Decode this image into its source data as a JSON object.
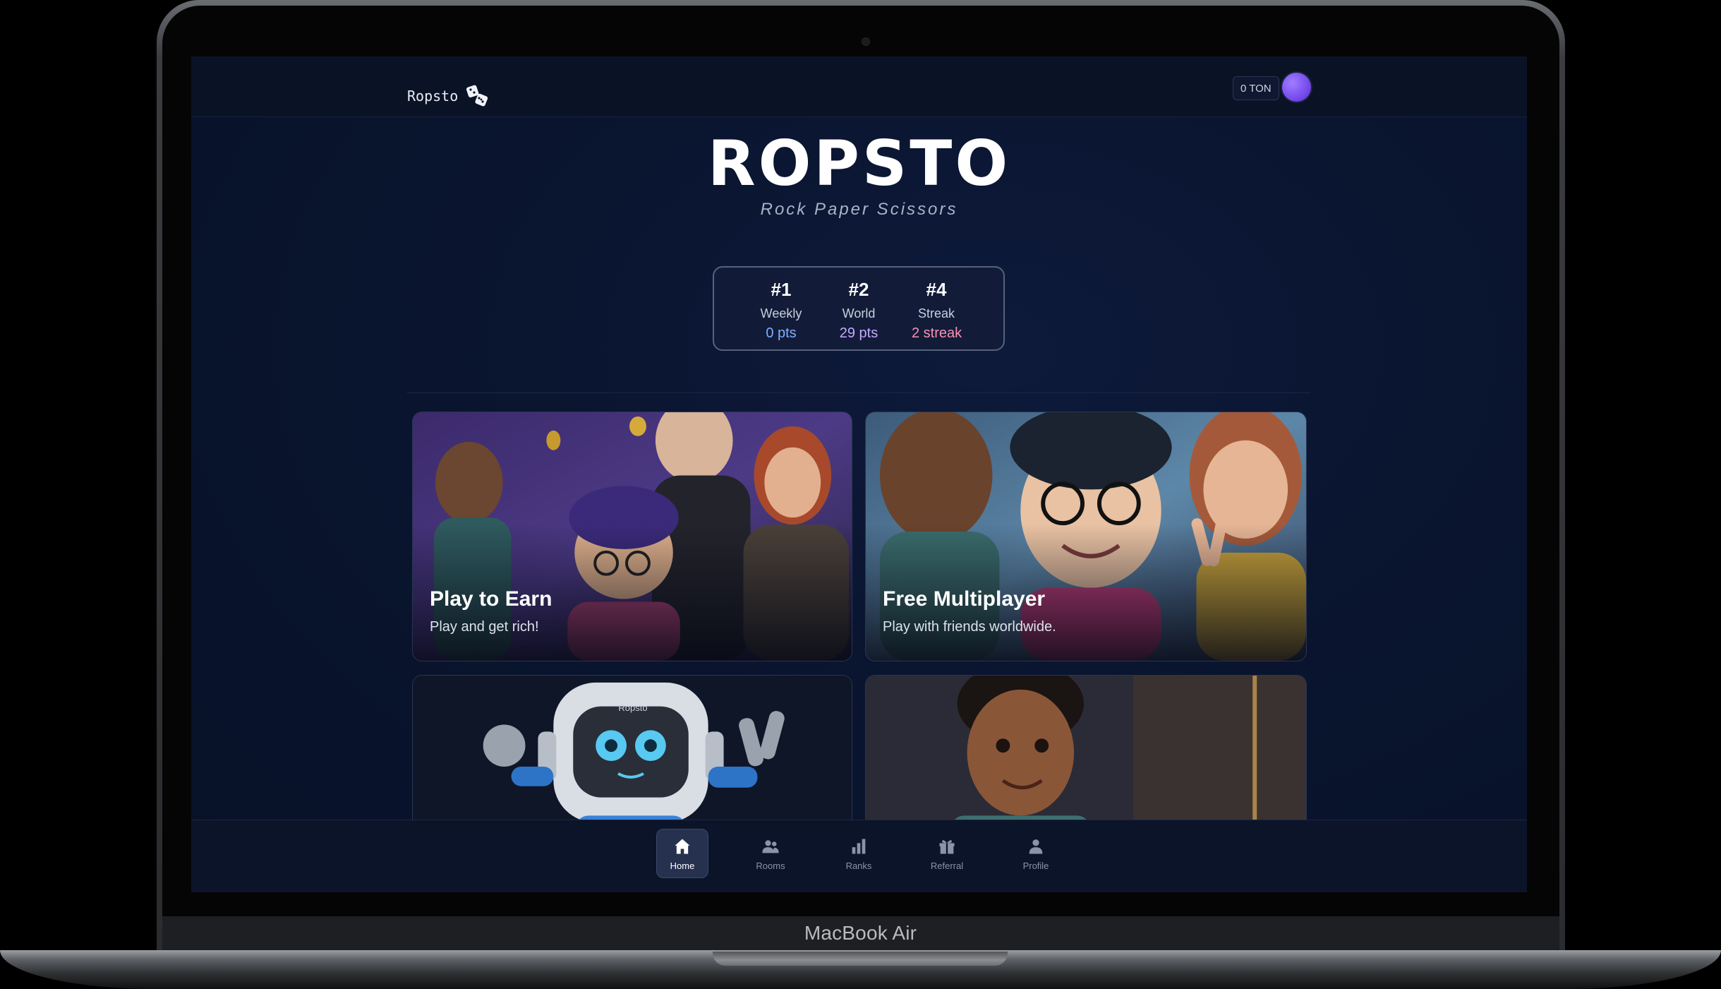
{
  "device": {
    "label": "MacBook Air"
  },
  "header": {
    "brand": "Ropsto",
    "wallet_balance": "0 TON"
  },
  "hero": {
    "title": "ROPSTO",
    "subtitle": "Rock Paper Scissors"
  },
  "stats": [
    {
      "rank": "#1",
      "label": "Weekly",
      "value": "0 pts",
      "color": "#7fb0ff"
    },
    {
      "rank": "#2",
      "label": "World",
      "value": "29 pts",
      "color": "#c8a8ff"
    },
    {
      "rank": "#4",
      "label": "Streak",
      "value": "2 streak",
      "color": "#ff8fb0"
    }
  ],
  "cards": [
    {
      "title": "Play to Earn",
      "description": "Play and get rich!"
    },
    {
      "title": "Free Multiplayer",
      "description": "Play with friends worldwide."
    },
    {
      "robot_badge": "Ropsto"
    }
  ],
  "nav": [
    {
      "label": "Home",
      "icon": "home-icon",
      "active": true
    },
    {
      "label": "Rooms",
      "icon": "users-icon"
    },
    {
      "label": "Ranks",
      "icon": "bar-chart-icon"
    },
    {
      "label": "Referral",
      "icon": "gift-icon"
    },
    {
      "label": "Profile",
      "icon": "user-icon"
    }
  ],
  "colors": {
    "background": "#0a1530",
    "accent": "#7a4ff0",
    "nav_active": "#26314f"
  }
}
